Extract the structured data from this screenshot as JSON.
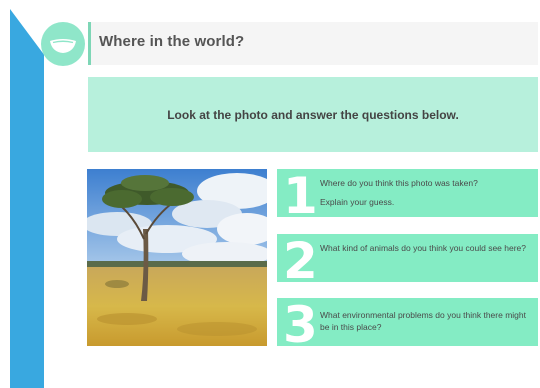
{
  "header": {
    "title": "Where in the world?"
  },
  "instruction": {
    "text": "Look at the photo and answer the questions below."
  },
  "questions": [
    {
      "number": "1",
      "text": "Where do you think this photo was taken?",
      "text2": "Explain your guess."
    },
    {
      "number": "2",
      "text": "What kind of animals do you think you could see here?"
    },
    {
      "number": "3",
      "text": "What environmental problems do you think there might be in this place?"
    }
  ],
  "colors": {
    "accent_blue": "#39a8e0",
    "mint_light": "#b7f0dc",
    "mint": "#84ecc4",
    "logo_mint": "#8fe6c9"
  },
  "icons": {
    "logo": "mouth-icon"
  }
}
